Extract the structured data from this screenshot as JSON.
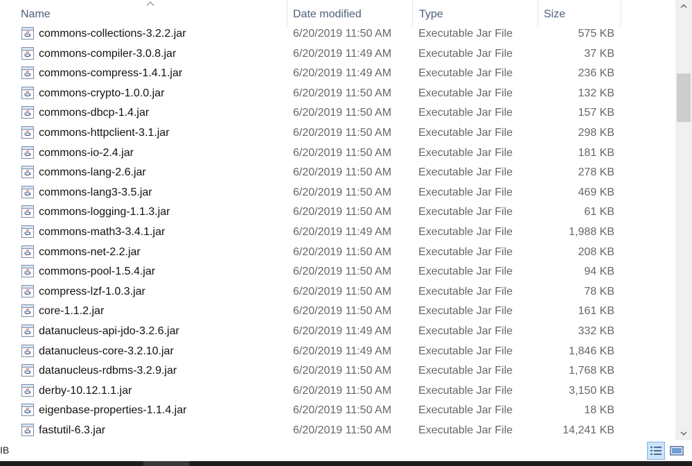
{
  "columns": {
    "name": "Name",
    "date": "Date modified",
    "type": "Type",
    "size": "Size"
  },
  "files": [
    {
      "name": "commons-collections-3.2.2.jar",
      "date": "6/20/2019 11:50 AM",
      "type": "Executable Jar File",
      "size": "575 KB"
    },
    {
      "name": "commons-compiler-3.0.8.jar",
      "date": "6/20/2019 11:49 AM",
      "type": "Executable Jar File",
      "size": "37 KB"
    },
    {
      "name": "commons-compress-1.4.1.jar",
      "date": "6/20/2019 11:49 AM",
      "type": "Executable Jar File",
      "size": "236 KB"
    },
    {
      "name": "commons-crypto-1.0.0.jar",
      "date": "6/20/2019 11:50 AM",
      "type": "Executable Jar File",
      "size": "132 KB"
    },
    {
      "name": "commons-dbcp-1.4.jar",
      "date": "6/20/2019 11:50 AM",
      "type": "Executable Jar File",
      "size": "157 KB"
    },
    {
      "name": "commons-httpclient-3.1.jar",
      "date": "6/20/2019 11:50 AM",
      "type": "Executable Jar File",
      "size": "298 KB"
    },
    {
      "name": "commons-io-2.4.jar",
      "date": "6/20/2019 11:50 AM",
      "type": "Executable Jar File",
      "size": "181 KB"
    },
    {
      "name": "commons-lang-2.6.jar",
      "date": "6/20/2019 11:50 AM",
      "type": "Executable Jar File",
      "size": "278 KB"
    },
    {
      "name": "commons-lang3-3.5.jar",
      "date": "6/20/2019 11:50 AM",
      "type": "Executable Jar File",
      "size": "469 KB"
    },
    {
      "name": "commons-logging-1.1.3.jar",
      "date": "6/20/2019 11:50 AM",
      "type": "Executable Jar File",
      "size": "61 KB"
    },
    {
      "name": "commons-math3-3.4.1.jar",
      "date": "6/20/2019 11:49 AM",
      "type": "Executable Jar File",
      "size": "1,988 KB"
    },
    {
      "name": "commons-net-2.2.jar",
      "date": "6/20/2019 11:50 AM",
      "type": "Executable Jar File",
      "size": "208 KB"
    },
    {
      "name": "commons-pool-1.5.4.jar",
      "date": "6/20/2019 11:50 AM",
      "type": "Executable Jar File",
      "size": "94 KB"
    },
    {
      "name": "compress-lzf-1.0.3.jar",
      "date": "6/20/2019 11:50 AM",
      "type": "Executable Jar File",
      "size": "78 KB"
    },
    {
      "name": "core-1.1.2.jar",
      "date": "6/20/2019 11:50 AM",
      "type": "Executable Jar File",
      "size": "161 KB"
    },
    {
      "name": "datanucleus-api-jdo-3.2.6.jar",
      "date": "6/20/2019 11:49 AM",
      "type": "Executable Jar File",
      "size": "332 KB"
    },
    {
      "name": "datanucleus-core-3.2.10.jar",
      "date": "6/20/2019 11:49 AM",
      "type": "Executable Jar File",
      "size": "1,846 KB"
    },
    {
      "name": "datanucleus-rdbms-3.2.9.jar",
      "date": "6/20/2019 11:50 AM",
      "type": "Executable Jar File",
      "size": "1,768 KB"
    },
    {
      "name": "derby-10.12.1.1.jar",
      "date": "6/20/2019 11:50 AM",
      "type": "Executable Jar File",
      "size": "3,150 KB"
    },
    {
      "name": "eigenbase-properties-1.1.4.jar",
      "date": "6/20/2019 11:50 AM",
      "type": "Executable Jar File",
      "size": "18 KB"
    },
    {
      "name": "fastutil-6.3.jar",
      "date": "6/20/2019 11:50 AM",
      "type": "Executable Jar File",
      "size": "14,241 KB"
    }
  ],
  "statusbar": {
    "text": "IB"
  },
  "icons": {
    "file": "java-jar-icon",
    "sort": "sort-ascending-icon"
  },
  "colors": {
    "header_text": "#4c607a",
    "detail_text": "#666666",
    "selected_view": "#cce4f7"
  }
}
